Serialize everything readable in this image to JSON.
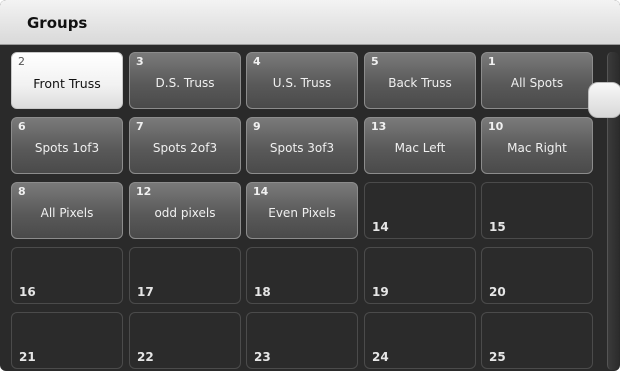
{
  "panel": {
    "title": "Groups"
  },
  "tiles": [
    {
      "num": "2",
      "label": "Front Truss",
      "state": "selected"
    },
    {
      "num": "3",
      "label": "D.S. Truss",
      "state": "filled"
    },
    {
      "num": "4",
      "label": "U.S. Truss",
      "state": "filled"
    },
    {
      "num": "5",
      "label": "Back Truss",
      "state": "filled"
    },
    {
      "num": "1",
      "label": "All Spots",
      "state": "filled"
    },
    {
      "num": "6",
      "label": "Spots 1of3",
      "state": "filled"
    },
    {
      "num": "7",
      "label": "Spots 2of3",
      "state": "filled"
    },
    {
      "num": "9",
      "label": "Spots 3of3",
      "state": "filled"
    },
    {
      "num": "13",
      "label": "Mac Left",
      "state": "filled"
    },
    {
      "num": "10",
      "label": "Mac Right",
      "state": "filled"
    },
    {
      "num": "8",
      "label": "All Pixels",
      "state": "filled"
    },
    {
      "num": "12",
      "label": "odd pixels",
      "state": "filled"
    },
    {
      "num": "14",
      "label": "Even Pixels",
      "state": "filled"
    },
    {
      "num": "14",
      "label": "",
      "state": "empty"
    },
    {
      "num": "15",
      "label": "",
      "state": "empty"
    },
    {
      "num": "16",
      "label": "",
      "state": "empty"
    },
    {
      "num": "17",
      "label": "",
      "state": "empty"
    },
    {
      "num": "18",
      "label": "",
      "state": "empty"
    },
    {
      "num": "19",
      "label": "",
      "state": "empty"
    },
    {
      "num": "20",
      "label": "",
      "state": "empty"
    },
    {
      "num": "21",
      "label": "",
      "state": "empty"
    },
    {
      "num": "22",
      "label": "",
      "state": "empty"
    },
    {
      "num": "23",
      "label": "",
      "state": "empty"
    },
    {
      "num": "24",
      "label": "",
      "state": "empty"
    },
    {
      "num": "25",
      "label": "",
      "state": "empty"
    }
  ]
}
